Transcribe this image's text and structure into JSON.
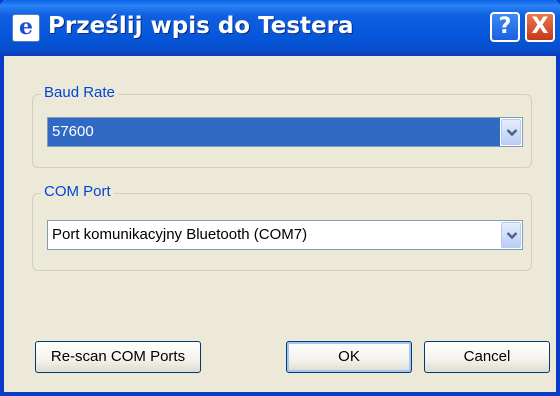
{
  "window": {
    "title": "Prześlij wpis do Testera"
  },
  "title_buttons": {
    "help": "?",
    "close": "X"
  },
  "baud_rate": {
    "label": "Baud Rate",
    "value": "57600"
  },
  "com_port": {
    "label": "COM Port",
    "value": "Port komunikacyjny Bluetooth (COM7)"
  },
  "buttons": {
    "rescan": "Re-scan COM Ports",
    "ok": "OK",
    "cancel": "Cancel"
  },
  "colors": {
    "titlebar": "#0758dc",
    "selection": "#316ac5",
    "group_label": "#0046d5",
    "dialog_bg": "#ece9d8"
  },
  "icons": {
    "app": "app-e-icon",
    "dropdown": "chevron-down-icon"
  }
}
